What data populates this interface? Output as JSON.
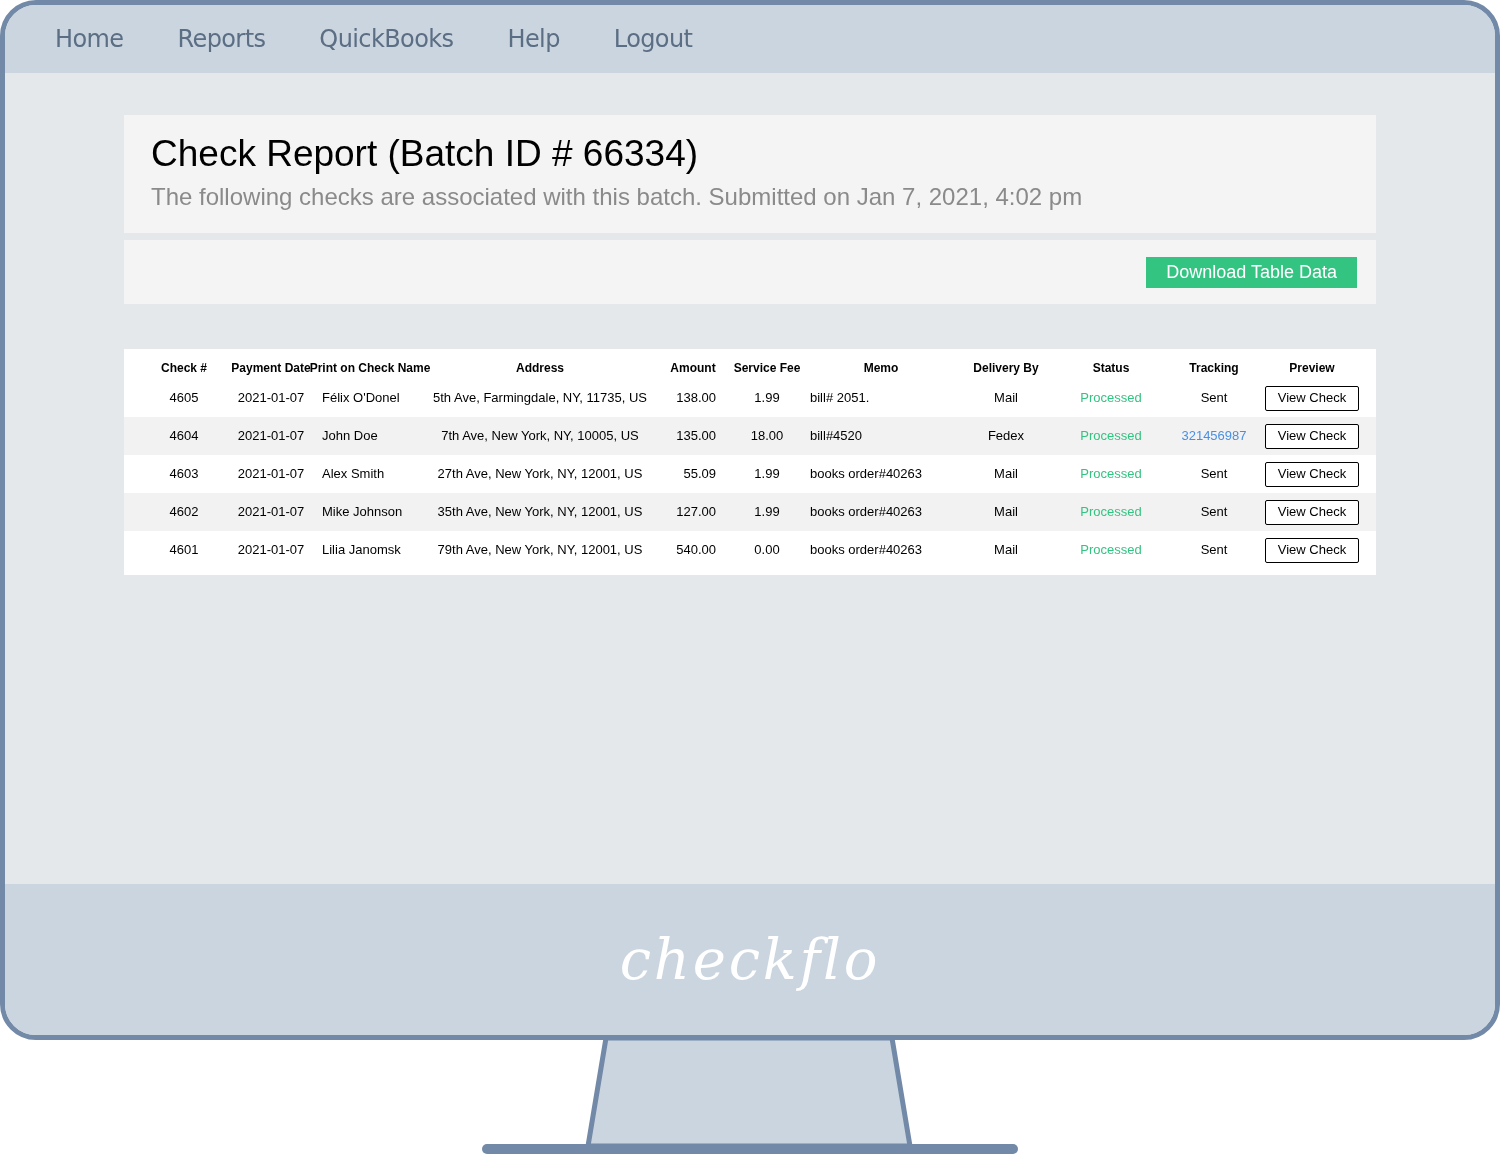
{
  "nav": [
    "Home",
    "Reports",
    "QuickBooks",
    "Help",
    "Logout"
  ],
  "header": {
    "title": "Check Report (Batch ID # 66334)",
    "subtitle": "The following checks are associated with this batch. Submitted on Jan 7, 2021, 4:02 pm"
  },
  "toolbar": {
    "button": "Download Table Data"
  },
  "table": {
    "columns": [
      "Check #",
      "Payment Date",
      "Print on Check Name",
      "Address",
      "Amount",
      "Service Fee",
      "Memo",
      "Delivery By",
      "Status",
      "Tracking",
      "Preview"
    ],
    "rows": [
      {
        "check": "4605",
        "date": "2021-01-07",
        "name": "Félix O'Donel",
        "address": "5th Ave, Farmingdale, NY, 11735, US",
        "amount": "138.00",
        "fee": "1.99",
        "memo": "bill# 2051.",
        "delivery": "Mail",
        "status": "Processed",
        "tracking": {
          "kind": "text",
          "text": "Sent"
        },
        "preview": "View Check"
      },
      {
        "check": "4604",
        "date": "2021-01-07",
        "name": "John Doe",
        "address": "7th Ave, New York, NY, 10005, US",
        "amount": "135.00",
        "fee": "18.00",
        "memo": "bill#4520",
        "delivery": "Fedex",
        "status": "Processed",
        "tracking": {
          "kind": "link",
          "text": "321456987"
        },
        "preview": "View Check"
      },
      {
        "check": "4603",
        "date": "2021-01-07",
        "name": "Alex Smith",
        "address": "27th Ave, New York, NY, 12001, US",
        "amount": "55.09",
        "fee": "1.99",
        "memo": "books order#40263",
        "delivery": "Mail",
        "status": "Processed",
        "tracking": {
          "kind": "text",
          "text": "Sent"
        },
        "preview": "View Check"
      },
      {
        "check": "4602",
        "date": "2021-01-07",
        "name": "Mike Johnson",
        "address": "35th Ave, New York, NY, 12001, US",
        "amount": "127.00",
        "fee": "1.99",
        "memo": "books order#40263",
        "delivery": "Mail",
        "status": "Processed",
        "tracking": {
          "kind": "text",
          "text": "Sent"
        },
        "preview": "View Check"
      },
      {
        "check": "4601",
        "date": "2021-01-07",
        "name": "Lilia Janomsk",
        "address": "79th Ave, New York, NY, 12001, US",
        "amount": "540.00",
        "fee": "0.00",
        "memo": "books order#40263",
        "delivery": "Mail",
        "status": "Processed",
        "tracking": {
          "kind": "text",
          "text": "Sent"
        },
        "preview": "View Check"
      }
    ]
  },
  "footer": {
    "logo": "checkflo"
  }
}
